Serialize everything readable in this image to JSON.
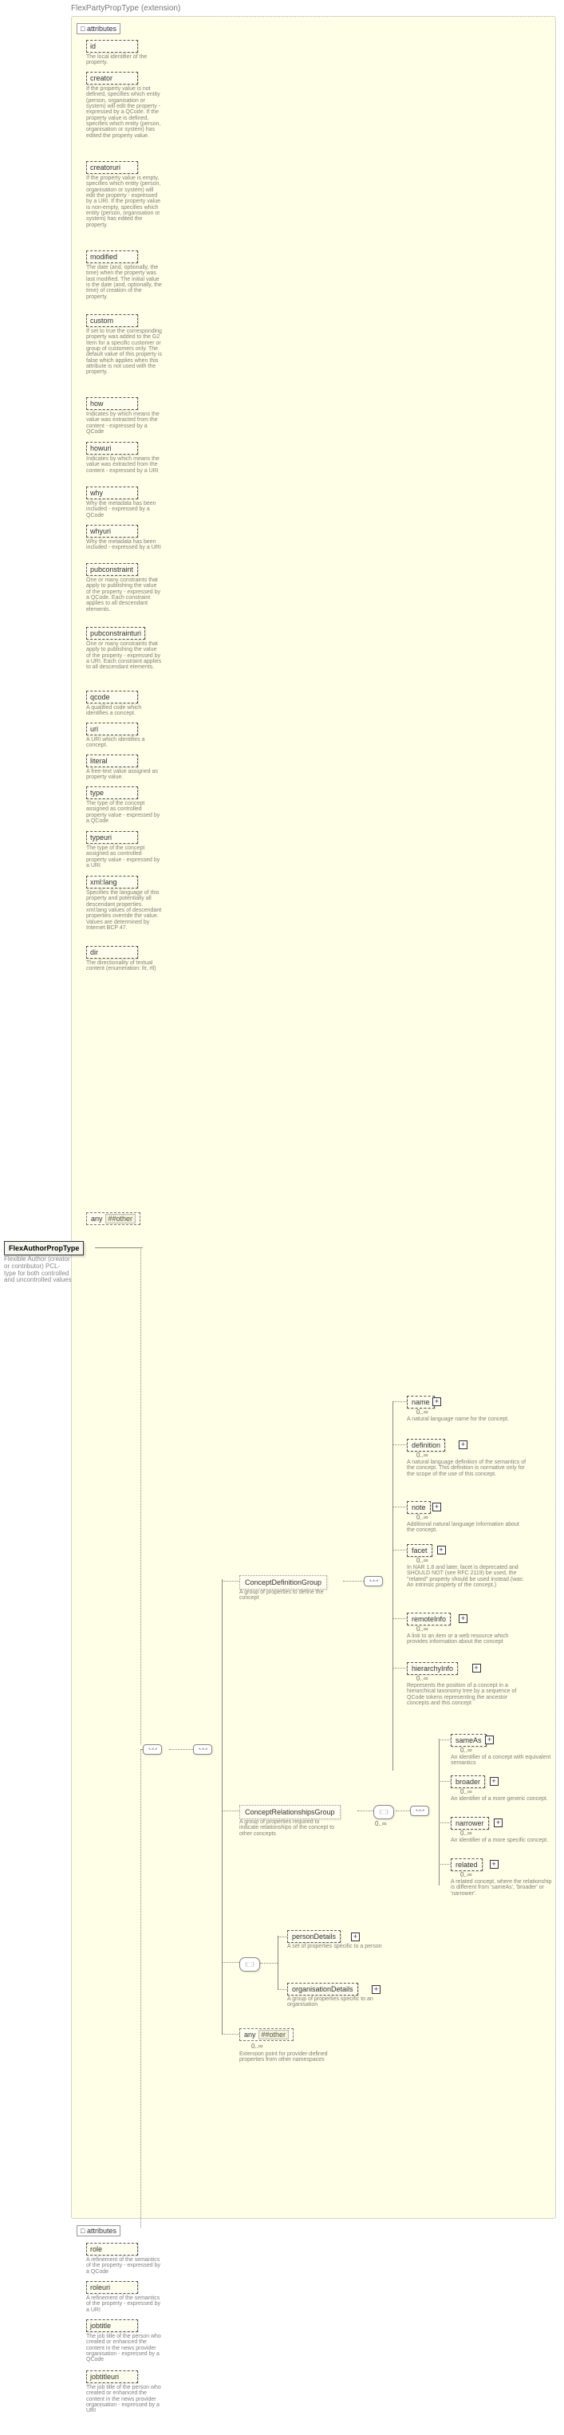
{
  "header": {
    "ext_label": "FlexPartyPropType (extension)"
  },
  "root": {
    "name": "FlexAuthorPropType",
    "doc": "Flexible Author (creator or contributor) PCL-type for both controlled and uncontrolled values"
  },
  "attrs_label": "attributes",
  "attrs": [
    {
      "n": "id",
      "d": "The local identifier of the property."
    },
    {
      "n": "creator",
      "d": "If the property value is not defined, specifies which entity (person, organisation or system) will edit the property - expressed by a QCode. If the property value is defined, specifies which entity (person, organisation or system) has edited the property value."
    },
    {
      "n": "creatoruri",
      "d": "If the property value is empty, specifies which entity (person, organisation or system) will edit the property - expressed by a URI. If the property value is non-empty, specifies which entity (person, organisation or system) has edited the property."
    },
    {
      "n": "modified",
      "d": "The date (and, optionally, the time) when the property was last modified. The initial value is the date (and, optionally, the time) of creation of the property."
    },
    {
      "n": "custom",
      "d": "If set to true the corresponding property was added to the G2 Item for a specific customer or group of customers only. The default value of this property is false which applies when this attribute is not used with the property."
    },
    {
      "n": "how",
      "d": "Indicates by which means the value was extracted from the content - expressed by a QCode"
    },
    {
      "n": "howuri",
      "d": "Indicates by which means the value was extracted from the content - expressed by a URI"
    },
    {
      "n": "why",
      "d": "Why the metadata has been included - expressed by a QCode"
    },
    {
      "n": "whyuri",
      "d": "Why the metadata has been included - expressed by a URI"
    },
    {
      "n": "pubconstraint",
      "d": "One or many constraints that apply to publishing the value of the property - expressed by a QCode. Each constraint applies to all descendant elements."
    },
    {
      "n": "pubconstrainturi",
      "d": "One or many constraints that apply to publishing the value of the property - expressed by a URI. Each constraint applies to all descendant elements."
    },
    {
      "n": "qcode",
      "d": "A qualified code which identifies a concept."
    },
    {
      "n": "uri",
      "d": "A URI which identifies a concept."
    },
    {
      "n": "literal",
      "d": "A free-text value assigned as property value."
    },
    {
      "n": "type",
      "d": "The type of the concept assigned as controlled property value - expressed by a QCode"
    },
    {
      "n": "typeuri",
      "d": "The type of the concept assigned as controlled property value - expressed by a URI"
    },
    {
      "n": "xml:lang",
      "d": "Specifies the language of this property and potentially all descendant properties. xml:lang values of descendant properties override the value. Values are determined by Internet BCP 47."
    },
    {
      "n": "dir",
      "d": "The directionality of textual content (enumeration: ltr, rtl)"
    }
  ],
  "any_other": {
    "label": "any",
    "ns": "##other"
  },
  "groups": {
    "def": {
      "name": "ConceptDefinitionGroup",
      "doc": "A group of properties to define the concept"
    },
    "rel": {
      "name": "ConceptRelationshipsGroup",
      "doc": "A group of properties required to indicate relationships of the concept to other concepts"
    },
    "pers": {
      "name": "personDetails",
      "doc": "A set of properties specific to a person"
    },
    "org": {
      "name": "organisationDetails",
      "doc": "A group of properties specific to an organisation"
    }
  },
  "def_children": [
    {
      "n": "name",
      "d": "A natural language name for the concept."
    },
    {
      "n": "definition",
      "d": "A natural language definition of the semantics of the concept. This definition is normative only for the scope of the use of this concept."
    },
    {
      "n": "note",
      "d": "Additional natural language information about the concept."
    },
    {
      "n": "facet",
      "d": "In NAR 1.8 and later, facet is deprecated and SHOULD NOT (see RFC 2119) be used, the \"related\" property should be used instead.(was: An intrinsic property of the concept.)"
    },
    {
      "n": "remoteInfo",
      "d": "A link to an item or a web resource which provides information about the concept"
    },
    {
      "n": "hierarchyInfo",
      "d": "Represents the position of a concept in a hierarchical taxonomy tree by a sequence of QCode tokens representing the ancestor concepts and this concept"
    }
  ],
  "rel_children": [
    {
      "n": "sameAs",
      "d": "An identifier of a concept with equivalent semantics"
    },
    {
      "n": "broader",
      "d": "An identifier of a more generic concept."
    },
    {
      "n": "narrower",
      "d": "An identifier of a more specific concept."
    },
    {
      "n": "related",
      "d": "A related concept, where the relationship is different from 'sameAs', 'broader' or 'narrower'."
    }
  ],
  "any_other2": {
    "label": "any",
    "ns": "##other",
    "doc": "Extension point for provider-defined properties from other namespaces"
  },
  "ext_attrs_label": "attributes",
  "ext_attrs": [
    {
      "n": "role",
      "d": "A refinement of the semantics of the property - expressed by a QCode"
    },
    {
      "n": "roleuri",
      "d": "A refinement of the semantics of the property - expressed by a URI"
    },
    {
      "n": "jobtitle",
      "d": "The job title of the person who created or enhanced the content in the news provider organisation - expressed by a QCode"
    },
    {
      "n": "jobtitleuri",
      "d": "The job title of the person who created or enhanced the content in the news provider organisation - expressed by a URI"
    }
  ],
  "card": {
    "zinf": "0..∞"
  }
}
